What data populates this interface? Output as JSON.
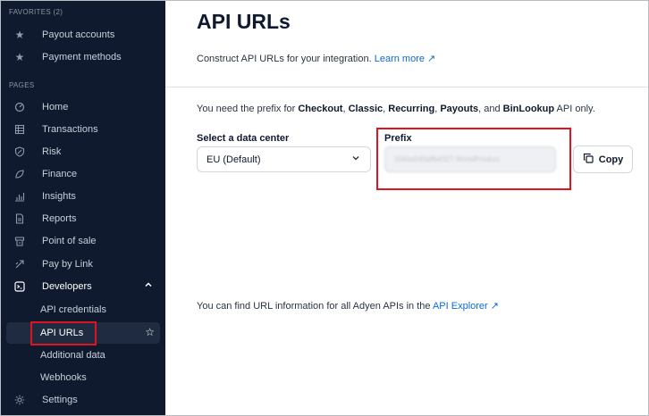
{
  "sidebar": {
    "favorites_heading": "FAVORITES (2)",
    "favorites": [
      {
        "label": "Payout accounts",
        "icon": "star-icon"
      },
      {
        "label": "Payment methods",
        "icon": "star-icon"
      }
    ],
    "pages_heading": "PAGES",
    "pages": [
      {
        "label": "Home",
        "icon": "home-icon"
      },
      {
        "label": "Transactions",
        "icon": "transactions-icon"
      },
      {
        "label": "Risk",
        "icon": "shield-icon"
      },
      {
        "label": "Finance",
        "icon": "finance-icon"
      },
      {
        "label": "Insights",
        "icon": "chart-icon"
      },
      {
        "label": "Reports",
        "icon": "document-icon"
      },
      {
        "label": "Point of sale",
        "icon": "terminal-icon"
      },
      {
        "label": "Pay by Link",
        "icon": "link-icon"
      }
    ],
    "developers": {
      "label": "Developers",
      "icon": "terminal-prompt-icon",
      "expanded_icon": "chevron-up-icon"
    },
    "developer_items": [
      "API credentials",
      "API URLs",
      "Additional data",
      "Webhooks"
    ],
    "active_item": "API URLs",
    "settings": {
      "label": "Settings",
      "icon": "gear-icon"
    }
  },
  "main": {
    "title": "API URLs",
    "description": "Construct API URLs for your integration.",
    "learn_more": "Learn more",
    "prefix_note": {
      "pre": "You need the prefix for ",
      "checkout": "Checkout",
      "sep1": ", ",
      "classic": "Classic",
      "sep2": ", ",
      "recurring": "Recurring",
      "sep3": ", ",
      "payouts": "Payouts",
      "sep4": ", and ",
      "binlookup": "BinLookup",
      "post": " API only."
    },
    "data_center_label": "Select a data center",
    "data_center_value": "EU (Default)",
    "prefix_label": "Prefix",
    "prefix_value": "1044a045bffb4327-WorldProduct",
    "copy_label": "Copy",
    "explorer_text": "You can find URL information for all Adyen APIs in the",
    "explorer_link": "API Explorer"
  },
  "colors": {
    "sidebar_bg": "#0f1a2e",
    "link": "#0a6cd6",
    "highlight": "#e0141e"
  }
}
